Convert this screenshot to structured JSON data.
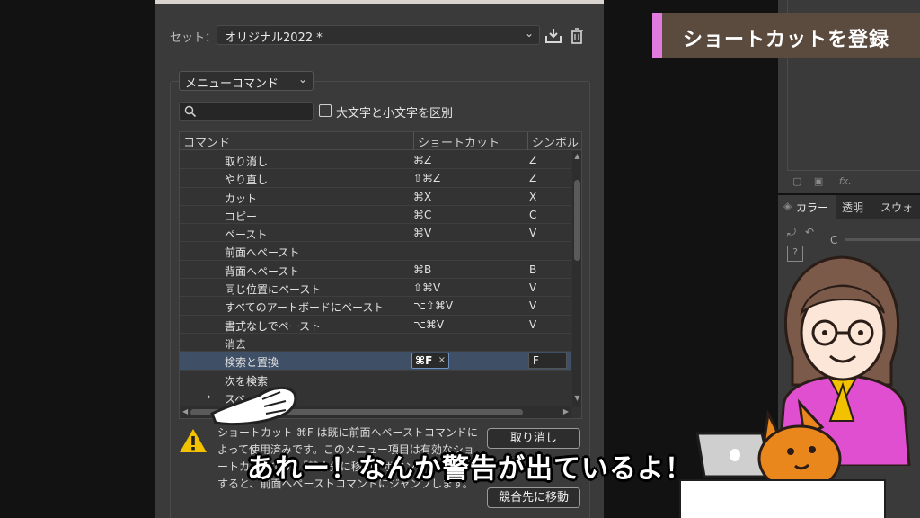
{
  "dialog": {
    "set_label": "セット：",
    "set_value": "オリジナル2022 *",
    "command_type": "メニューコマンド",
    "search_placeholder": "",
    "case_label": "大文字と小文字を区別",
    "columns": [
      "コマンド",
      "ショートカット",
      "シンボル"
    ],
    "rows": [
      {
        "command": "取り消し",
        "shortcut": "⌘Z",
        "symbol": "Z"
      },
      {
        "command": "やり直し",
        "shortcut": "⇧⌘Z",
        "symbol": "Z"
      },
      {
        "command": "カット",
        "shortcut": "⌘X",
        "symbol": "X"
      },
      {
        "command": "コピー",
        "shortcut": "⌘C",
        "symbol": "C"
      },
      {
        "command": "ペースト",
        "shortcut": "⌘V",
        "symbol": "V"
      },
      {
        "command": "前面へペースト",
        "shortcut": "",
        "symbol": ""
      },
      {
        "command": "背面へペースト",
        "shortcut": "⌘B",
        "symbol": "B"
      },
      {
        "command": "同じ位置にペースト",
        "shortcut": "⇧⌘V",
        "symbol": "V"
      },
      {
        "command": "すべてのアートボードにペースト",
        "shortcut": "⌥⇧⌘V",
        "symbol": "V"
      },
      {
        "command": "書式なしでペースト",
        "shortcut": "⌥⌘V",
        "symbol": "V"
      },
      {
        "command": "消去",
        "shortcut": "",
        "symbol": ""
      }
    ],
    "selected_row": {
      "command": "検索と置換",
      "shortcut": "⌘F",
      "clear": "×",
      "symbol": "F"
    },
    "row_next": {
      "command": "次を検索"
    },
    "row_spell": {
      "command": "スペ",
      "expand": "›"
    },
    "warning_text": "ショートカット ⌘F は既に前面へペーストコマンドによって使用済みです。このメニュー項目は有効なショートカットです。「競合先に移動」ボタンをクリックすると、前面へペーストコマンドにジャンプします。",
    "undo_button": "取り消し",
    "goto_conflict_button": "競合先に移動"
  },
  "right_panel": {
    "tabs": [
      "カラー",
      "透明",
      "スウォッ"
    ],
    "fx_label": "fx.",
    "c_label": "C"
  },
  "banner": {
    "title": "ショートカットを登録"
  },
  "subtitle": "あれー！なんか警告が出ているよ！",
  "colors": {
    "dialog_bg": "#3a3a3a",
    "selection": "#3f4f66",
    "banner_bg": "#5b4a3e",
    "banner_accent": "#e27be0",
    "warning": "#f2c200"
  }
}
